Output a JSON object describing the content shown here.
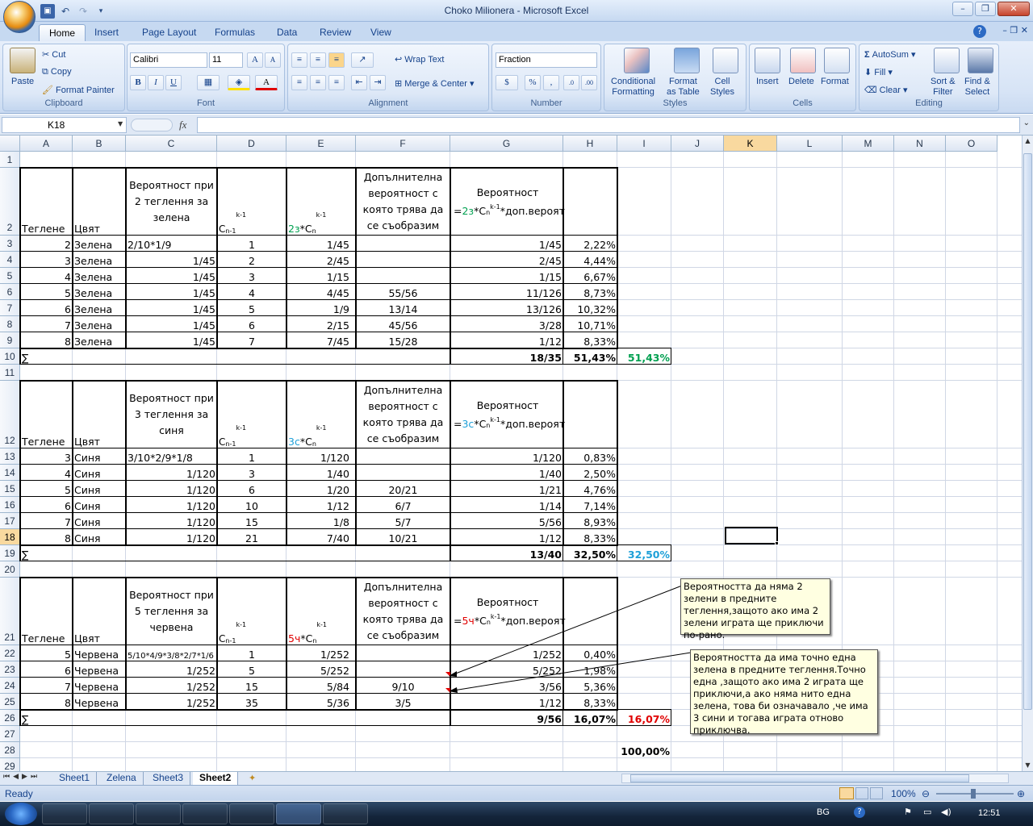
{
  "window": {
    "title": "Choko Milionera - Microsoft Excel"
  },
  "ribbon": {
    "tabs": [
      "Home",
      "Insert",
      "Page Layout",
      "Formulas",
      "Data",
      "Review",
      "View"
    ],
    "clipboard": {
      "paste": "Paste",
      "cut": "Cut",
      "copy": "Copy",
      "format_painter": "Format Painter",
      "label": "Clipboard"
    },
    "font": {
      "name": "Calibri",
      "size": "11",
      "label": "Font",
      "bold": "B",
      "italic": "I",
      "underline": "U"
    },
    "alignment": {
      "wrap": "Wrap Text",
      "merge": "Merge & Center",
      "label": "Alignment"
    },
    "number": {
      "format": "Fraction",
      "label": "Number",
      "percent": "%",
      "comma": ","
    },
    "styles": {
      "cond_1": "Conditional",
      "cond_2": "Formatting",
      "fmt_1": "Format",
      "fmt_2": "as Table",
      "cell_1": "Cell",
      "cell_2": "Styles",
      "label": "Styles"
    },
    "cells": {
      "insert": "Insert",
      "delete": "Delete",
      "format": "Format",
      "label": "Cells"
    },
    "editing": {
      "autosum": "AutoSum",
      "fill": "Fill",
      "clear": "Clear",
      "sort_1": "Sort &",
      "sort_2": "Filter",
      "find_1": "Find &",
      "find_2": "Select",
      "label": "Editing"
    }
  },
  "formula_bar": {
    "name_box": "K18",
    "fx": "fx",
    "formula": ""
  },
  "columns": [
    "A",
    "B",
    "C",
    "D",
    "E",
    "F",
    "G",
    "H",
    "I",
    "J",
    "K",
    "L",
    "M",
    "N",
    "O"
  ],
  "rows": [
    "1",
    "2",
    "3",
    "4",
    "5",
    "6",
    "7",
    "8",
    "9",
    "10",
    "11",
    "12",
    "13",
    "14",
    "15",
    "16",
    "17",
    "18",
    "19",
    "20",
    "21",
    "22",
    "23",
    "24",
    "25",
    "26",
    "27",
    "28",
    "29"
  ],
  "table1": {
    "header": {
      "a": "Теглене",
      "b": "Цвят",
      "c": "Вероятност при 2 теглення за зелена",
      "d_main": "C",
      "d_sub": "n-1",
      "d_sup": "k-1",
      "e_pre": "2з",
      "e_mid": "*C",
      "e_sub": "n",
      "e_sup": "k-1",
      "f": "Допълнителна вероятност с която трява да се съобразим",
      "g_top": "Вероятност",
      "g_eq": "=",
      "g_col": "2з",
      "g_c": "*C",
      "g_sub": "n",
      "g_sup": "k-1",
      "g_rest": "*доп.вероят"
    },
    "rows": [
      {
        "a": "2",
        "b": "Зелена",
        "c": "2/10*1/9",
        "d": "1",
        "e": "1/45",
        "f": "",
        "g": "1/45",
        "h": "2,22%"
      },
      {
        "a": "3",
        "b": "Зелена",
        "c": "1/45",
        "d": "2",
        "e": "2/45",
        "f": "",
        "g": "2/45",
        "h": "4,44%"
      },
      {
        "a": "4",
        "b": "Зелена",
        "c": "1/45",
        "d": "3",
        "e": "1/15",
        "f": "",
        "g": "1/15",
        "h": "6,67%"
      },
      {
        "a": "5",
        "b": "Зелена",
        "c": "1/45",
        "d": "4",
        "e": "4/45",
        "f": "55/56",
        "g": "11/126",
        "h": "8,73%"
      },
      {
        "a": "6",
        "b": "Зелена",
        "c": "1/45",
        "d": "5",
        "e": "1/9",
        "f": "13/14",
        "g": "13/126",
        "h": "10,32%"
      },
      {
        "a": "7",
        "b": "Зелена",
        "c": "1/45",
        "d": "6",
        "e": "2/15",
        "f": "45/56",
        "g": "3/28",
        "h": "10,71%"
      },
      {
        "a": "8",
        "b": "Зелена",
        "c": "1/45",
        "d": "7",
        "e": "7/45",
        "f": "15/28",
        "g": "1/12",
        "h": "8,33%"
      }
    ],
    "total": {
      "a": "∑",
      "g": "18/35",
      "h": "51,43%",
      "i": "51,43%"
    }
  },
  "table2": {
    "header": {
      "a": "Теглене",
      "b": "Цвят",
      "c": "Вероятност при 3 теглення за синя",
      "d_main": "C",
      "d_sub": "n-1",
      "d_sup": "k-1",
      "e_pre": "3с",
      "e_mid": "*C",
      "e_sub": "n",
      "e_sup": "k-1",
      "f": "Допълнителна вероятност с която трява да се съобразим",
      "g_top": "Вероятност",
      "g_eq": "=",
      "g_col": "3с",
      "g_c": "*C",
      "g_sub": "n",
      "g_sup": "k-1",
      "g_rest": "*доп.вероят"
    },
    "rows": [
      {
        "a": "3",
        "b": "Синя",
        "c": "3/10*2/9*1/8",
        "d": "1",
        "e": "1/120",
        "f": "",
        "g": "1/120",
        "h": "0,83%"
      },
      {
        "a": "4",
        "b": "Синя",
        "c": "1/120",
        "d": "3",
        "e": "1/40",
        "f": "",
        "g": "1/40",
        "h": "2,50%"
      },
      {
        "a": "5",
        "b": "Синя",
        "c": "1/120",
        "d": "6",
        "e": "1/20",
        "f": "20/21",
        "g": "1/21",
        "h": "4,76%"
      },
      {
        "a": "6",
        "b": "Синя",
        "c": "1/120",
        "d": "10",
        "e": "1/12",
        "f": "6/7",
        "g": "1/14",
        "h": "7,14%"
      },
      {
        "a": "7",
        "b": "Синя",
        "c": "1/120",
        "d": "15",
        "e": "1/8",
        "f": "5/7",
        "g": "5/56",
        "h": "8,93%"
      },
      {
        "a": "8",
        "b": "Синя",
        "c": "1/120",
        "d": "21",
        "e": "7/40",
        "f": "10/21",
        "g": "1/12",
        "h": "8,33%"
      }
    ],
    "total": {
      "a": "∑",
      "g": "13/40",
      "h": "32,50%",
      "i": "32,50%"
    }
  },
  "table3": {
    "header": {
      "a": "Теглене",
      "b": "Цвят",
      "c": "Вероятност при 5 теглення за червена",
      "d_main": "C",
      "d_sub": "n-1",
      "d_sup": "k-1",
      "e_pre": "5ч",
      "e_mid": "*C",
      "e_sub": "n",
      "e_sup": "k-1",
      "f": "Допълнителна вероятност с която трява да се съобразим",
      "g_top": "Вероятност",
      "g_eq": "=",
      "g_col": "5ч",
      "g_c": "*C",
      "g_sub": "n",
      "g_sup": "k-1",
      "g_rest": "*доп.вероят"
    },
    "rows": [
      {
        "a": "5",
        "b": "Червена",
        "c": "5/10*4/9*3/8*2/7*1/6",
        "d": "1",
        "e": "1/252",
        "f": "",
        "g": "1/252",
        "h": "0,40%"
      },
      {
        "a": "6",
        "b": "Червена",
        "c": "1/252",
        "d": "5",
        "e": "5/252",
        "f": "",
        "g": "5/252",
        "h": "1,98%"
      },
      {
        "a": "7",
        "b": "Червена",
        "c": "1/252",
        "d": "15",
        "e": "5/84",
        "f": "9/10",
        "g": "3/56",
        "h": "5,36%"
      },
      {
        "a": "8",
        "b": "Червена",
        "c": "1/252",
        "d": "35",
        "e": "5/36",
        "f": "3/5",
        "g": "1/12",
        "h": "8,33%"
      }
    ],
    "total": {
      "a": "∑",
      "g": "9/56",
      "h": "16,07%",
      "i": "16,07%"
    }
  },
  "grand_total": "100,00%",
  "comments": [
    "Вероятността да няма 2 зелени в предните теглення,защото ако има 2 зелени играта ще приключи по-рано.",
    "Вероятността да има точно една зелена в предните теглення.Точно една ,защото ако има 2 играта ще приключи,а ако няма нито една зелена, това би означавало ,че има 3 сини и тогава играта отново приключва."
  ],
  "sheets": [
    "Sheet1",
    "Zelena",
    "Sheet3",
    "Sheet2"
  ],
  "status": {
    "ready": "Ready",
    "zoom": "100%"
  },
  "taskbar": {
    "lang": "BG",
    "time": "12:51"
  },
  "colors": {
    "green": "#00a050",
    "blue": "#1ea0d8",
    "red": "#e00000",
    "selected_header": "#f9d99f"
  }
}
